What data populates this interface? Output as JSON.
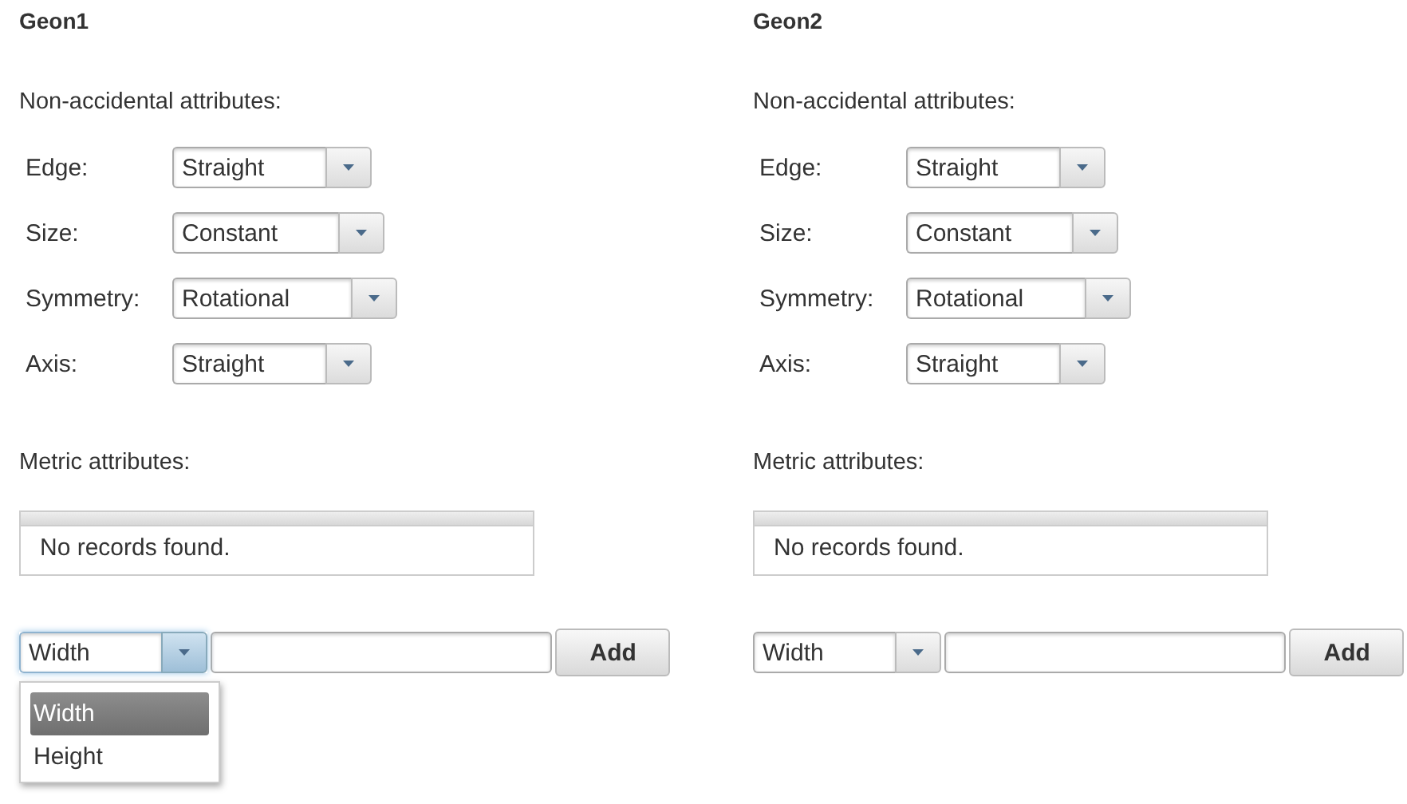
{
  "geons": [
    {
      "title": "Geon1",
      "nonaccidental_label": "Non-accidental attributes:",
      "attributes": [
        {
          "label": "Edge:",
          "value": "Straight"
        },
        {
          "label": "Size:",
          "value": "Constant"
        },
        {
          "label": "Symmetry:",
          "value": "Rotational"
        },
        {
          "label": "Axis:",
          "value": "Straight"
        }
      ],
      "metric_label": "Metric attributes:",
      "table": {
        "empty_text": "No records found."
      },
      "add_row": {
        "value": "Width",
        "expanded": true,
        "options": [
          {
            "label": "Width",
            "selected": true
          },
          {
            "label": "Height",
            "selected": false
          }
        ],
        "button": "Add"
      }
    },
    {
      "title": "Geon2",
      "nonaccidental_label": "Non-accidental attributes:",
      "attributes": [
        {
          "label": "Edge:",
          "value": "Straight"
        },
        {
          "label": "Size:",
          "value": "Constant"
        },
        {
          "label": "Symmetry:",
          "value": "Rotational"
        },
        {
          "label": "Axis:",
          "value": "Straight"
        }
      ],
      "metric_label": "Metric attributes:",
      "table": {
        "empty_text": "No records found."
      },
      "add_row": {
        "value": "Width",
        "expanded": false,
        "button": "Add"
      }
    }
  ]
}
